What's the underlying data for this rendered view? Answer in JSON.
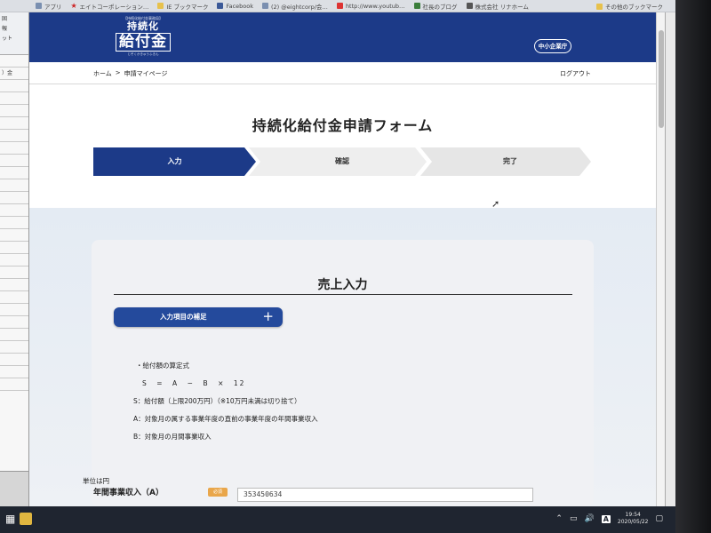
{
  "bookmarks": {
    "items": [
      {
        "label": "アプリ",
        "icon": "apps-grid-icon"
      },
      {
        "label": "エイトコーポレーション…",
        "icon": "bookmark-star-icon"
      },
      {
        "label": "IE ブックマーク",
        "icon": "folder-icon"
      },
      {
        "label": "Facebook",
        "icon": "facebook-icon"
      },
      {
        "label": "(2) @eightcorp/会…",
        "icon": "page-icon"
      },
      {
        "label": "http://www.youtub…",
        "icon": "youtube-icon"
      },
      {
        "label": "社長のブログ",
        "icon": "blog-icon"
      },
      {
        "label": "株式会社 リナホーム",
        "icon": "page-icon"
      }
    ],
    "other": "その他のブックマーク"
  },
  "sheet": {
    "top_lines": [
      "",
      "固",
      "報",
      "ット"
    ],
    "rows": [
      "",
      "）金",
      "",
      "",
      "",
      "",
      "",
      "",
      "",
      "",
      "",
      "",
      "",
      "",
      "",
      "",
      "",
      "",
      "",
      "",
      "",
      "",
      "",
      "",
      "",
      "",
      ""
    ]
  },
  "header": {
    "logo_small": "【持続化給付金事務局】",
    "logo_top": "持続化",
    "logo_main": "給付金",
    "logo_sub": "じぞくかきゅうふきん",
    "agency": "中小企業庁"
  },
  "nav": {
    "home": "ホーム",
    "separator": ">",
    "current": "申請マイページ",
    "logout": "ログアウト"
  },
  "form": {
    "title": "持続化給付金申請フォーム",
    "steps": [
      {
        "label": "入力",
        "active": true
      },
      {
        "label": "確認",
        "active": false
      },
      {
        "label": "完了",
        "active": false
      }
    ],
    "section_title": "売上入力",
    "supplement_button": "入力項目の補足",
    "supplement_plus": "+",
    "formula_heading": "・給付額の算定式",
    "formula_equation": "S　=　A　−　B　×　12",
    "formula_s": "S：給付額（上限200万円）（※10万円未満は切り捨て）",
    "formula_a": "A：対象月の属する事業年度の直前の事業年度の年間事業収入",
    "formula_b": "B：対象月の月間事業収入",
    "unit_label": "単位は円",
    "annual_label": "年間事業収入（A）",
    "required_badge": "必須",
    "annual_value": "353450634"
  },
  "taskbar": {
    "ime": "A",
    "time": "19:54",
    "date": "2020/05/22"
  },
  "colors": {
    "brand_blue": "#1c3a88",
    "button_blue": "#244a9c",
    "required_orange": "#e9a64a"
  }
}
